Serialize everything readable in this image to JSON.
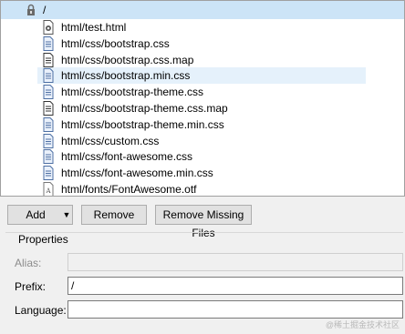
{
  "tree": {
    "root_label": "/",
    "files": [
      {
        "name": "html/test.html",
        "icon": "html-file-icon"
      },
      {
        "name": "html/css/bootstrap.css",
        "icon": "css-file-icon"
      },
      {
        "name": "html/css/bootstrap.css.map",
        "icon": "text-file-icon"
      },
      {
        "name": "html/css/bootstrap.min.css",
        "icon": "css-file-icon"
      },
      {
        "name": "html/css/bootstrap-theme.css",
        "icon": "css-file-icon"
      },
      {
        "name": "html/css/bootstrap-theme.css.map",
        "icon": "text-file-icon"
      },
      {
        "name": "html/css/bootstrap-theme.min.css",
        "icon": "css-file-icon"
      },
      {
        "name": "html/css/custom.css",
        "icon": "css-file-icon"
      },
      {
        "name": "html/css/font-awesome.css",
        "icon": "css-file-icon"
      },
      {
        "name": "html/css/font-awesome.min.css",
        "icon": "css-file-icon"
      },
      {
        "name": "html/fonts/FontAwesome.otf",
        "icon": "font-file-icon"
      }
    ],
    "selected_index": 3
  },
  "toolbar": {
    "add_label": "Add",
    "remove_label": "Remove",
    "remove_missing_label": "Remove Missing Files"
  },
  "properties": {
    "title": "Properties",
    "alias_label": "Alias:",
    "alias_value": "",
    "prefix_label": "Prefix:",
    "prefix_value": "/",
    "language_label": "Language:",
    "language_value": ""
  },
  "watermark": "@稀土掘金技术社区",
  "colors": {
    "selection": "#cce4f7",
    "hover_row": "#e5f1fb"
  }
}
